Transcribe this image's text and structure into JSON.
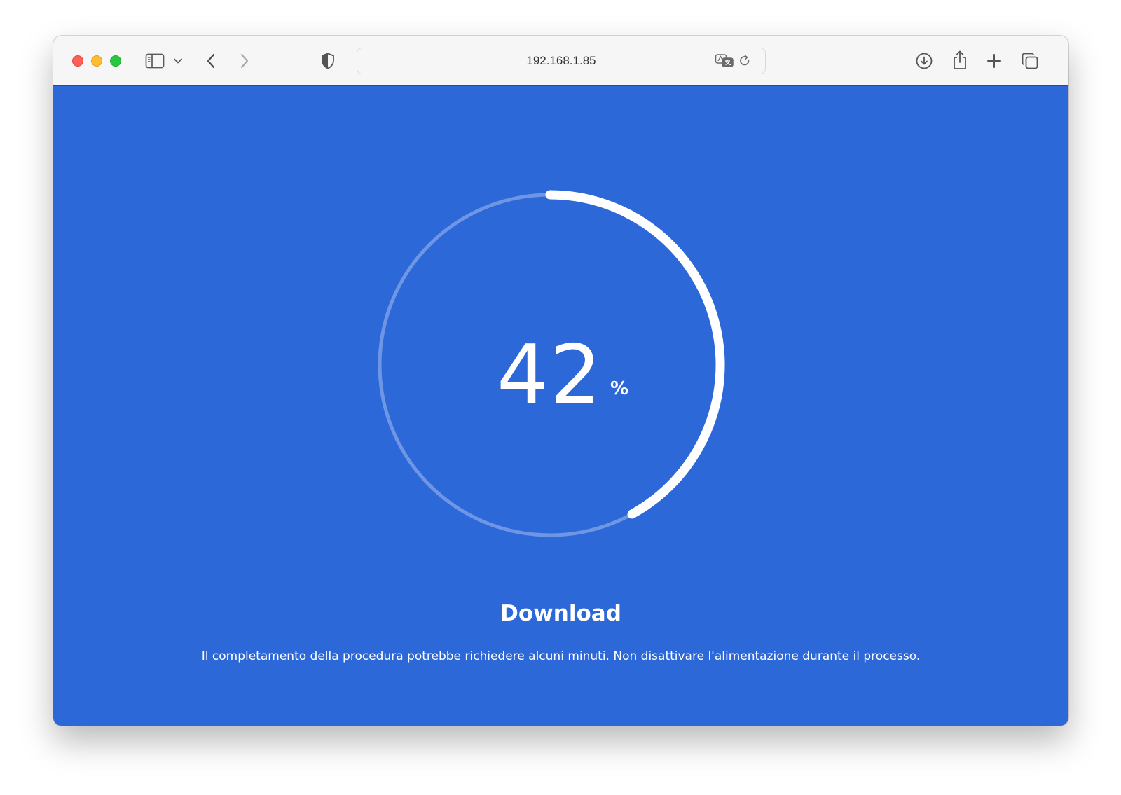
{
  "browser": {
    "address": "192.168.1.85",
    "icons": {
      "sidebar": "sidebar-icon",
      "sidebar_menu": "chevron-down-icon",
      "back": "chevron-left-icon",
      "forward": "chevron-right-icon",
      "privacy": "shield-icon",
      "translate": "translate-icon",
      "reload": "reload-icon",
      "downloads": "download-icon",
      "share": "share-icon",
      "new_tab": "plus-icon",
      "tabs": "tab-overview-icon"
    }
  },
  "page": {
    "progress_percent": 42,
    "percent_number": "42",
    "percent_sign": "%",
    "title": "Download",
    "description": "Il completamento della procedura potrebbe richiedere alcuni minuti. Non disattivare l'alimentazione durante il processo."
  },
  "colors": {
    "background": "#2d68d9",
    "progress": "#ffffff",
    "track": "#6f96e4"
  }
}
